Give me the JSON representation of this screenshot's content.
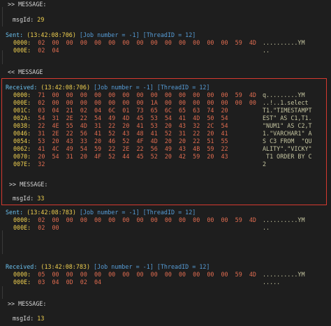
{
  "log": {
    "message_label": ">> MESSAGE:",
    "message_label_in": "<< MESSAGE",
    "msgid_label": "msgId:",
    "blocks": [
      {
        "kind": "msgid_top",
        "msgid": "29"
      },
      {
        "kind": "sent1",
        "direction": "Sent:",
        "time": "(13:42:08:706)",
        "meta": "[Job number = -1] [ThreadID = 12]",
        "rows": [
          {
            "off": "0000:",
            "hex": "02  00  00  00  00  00  00  00  00  00  00  00  00  00  59  4D",
            "asc": "..........YM"
          },
          {
            "off": "000E:",
            "hex": "02  04",
            "asc": ".."
          }
        ]
      },
      {
        "kind": "received1",
        "direction": "Received:",
        "time": "(13:42:08:706)",
        "meta": "[Job number = -1] [ThreadID = 12]",
        "rows": [
          {
            "off": "0000:",
            "hex": "71  00  00  00  00  00  00  00  00  00  00  00  00  00  59  4D",
            "asc": "q.........YM"
          },
          {
            "off": "000E:",
            "hex": "02  00  00  00  00  00  00  00  1A  00  00  00  00  00  00  00",
            "asc": "..!..1.select"
          },
          {
            "off": "001C:",
            "hex": "03  04  21  02  04  6C  01  73  65  6C  65  63  74  20",
            "asc": "T1.\"TIMESTAMPT"
          },
          {
            "off": "002A:",
            "hex": "54  31  2E  22  54  49  4D  45  53  54  41  4D  50  54",
            "asc": "EST\" AS C1,T1."
          },
          {
            "off": "0038:",
            "hex": "22  4E  55  4D  31  22  20  41  53  20  43  32  2C  54",
            "asc": "\"NUM1\" AS C2,T"
          },
          {
            "off": "0046:",
            "hex": "31  2E  22  56  41  52  43  48  41  52  31  22  20  41",
            "asc": "1.\"VARCHAR1\" A"
          },
          {
            "off": "0054:",
            "hex": "53  20  43  33  20  46  52  4F  4D  20  20  22  51  55",
            "asc": "S C3 FROM  \"QU"
          },
          {
            "off": "0062:",
            "hex": "41  4C  49  54  59  22  2E  22  56  49  43  4B  59  22",
            "asc": "ALITY\".\"VICKY\""
          },
          {
            "off": "0070:",
            "hex": "20  54  31  20  4F  52  44  45  52  20  42  59  20  43",
            "asc": " T1 ORDER BY C"
          },
          {
            "off": "007E:",
            "hex": "32",
            "asc": "2"
          }
        ]
      },
      {
        "kind": "msgid_mid",
        "msgid": "33"
      },
      {
        "kind": "sent2",
        "direction": "Sent:",
        "time": "(13:42:08:783)",
        "meta": "[Job number = -1] [ThreadID = 12]",
        "rows": [
          {
            "off": "0000:",
            "hex": "02  00  00  00  00  00  00  00  00  00  00  00  00  00  59  4D",
            "asc": "..........YM"
          },
          {
            "off": "000E:",
            "hex": "02  00",
            "asc": ".."
          }
        ]
      },
      {
        "kind": "received2",
        "direction": "Received:",
        "time": "(13:42:08:783)",
        "meta": "[Job number = -1] [ThreadID = 12]",
        "rows": [
          {
            "off": "0000:",
            "hex": "05  00  00  00  00  00  00  00  00  00  00  00  00  00  59  4D",
            "asc": "..........YM"
          },
          {
            "off": "000E:",
            "hex": "03  04  0D  02  04",
            "asc": "....."
          }
        ]
      },
      {
        "kind": "msgid_bottom",
        "msgid": "13"
      }
    ]
  }
}
